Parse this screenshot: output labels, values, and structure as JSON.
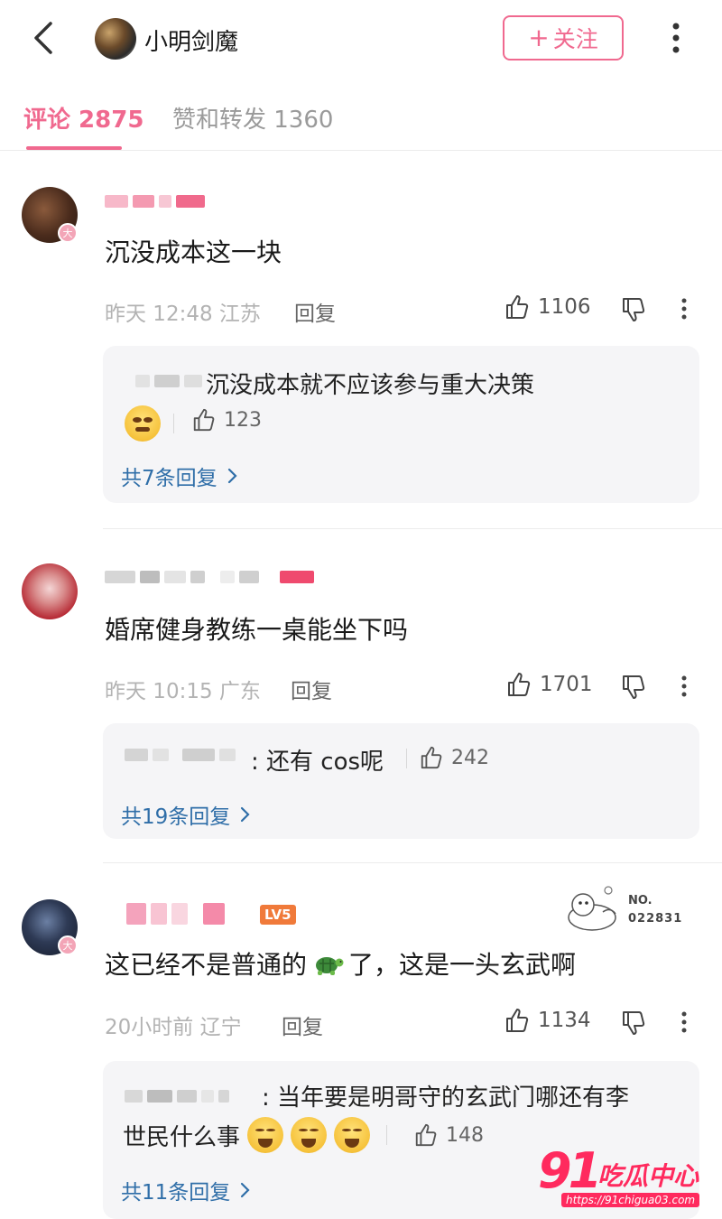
{
  "header": {
    "title": "小明剑魔",
    "follow_label": "关注",
    "follow_plus": "+"
  },
  "tabs": [
    {
      "label": "评论 2875",
      "active": true
    },
    {
      "label": "赞和转发 1360",
      "active": false
    }
  ],
  "comments": [
    {
      "text": "沉没成本这一块",
      "time": "昨天 12:48",
      "location": "江苏",
      "reply_label": "回复",
      "likes": "1106",
      "avatar_badge": "大",
      "reply": {
        "text": "沉没成本就不应该参与重大决策",
        "likes": "123",
        "count_label": "共7条回复"
      }
    },
    {
      "text": "婚席健身教练一桌能坐下吗",
      "time": "昨天 10:15",
      "location": "广东",
      "reply_label": "回复",
      "likes": "1701",
      "reply": {
        "text": ": 还有 cos呢",
        "likes": "242",
        "count_label": "共19条回复"
      }
    },
    {
      "text_before": "这已经不是普通的",
      "text_after": "了，这是一头玄武啊",
      "time": "20小时前",
      "location": "辽宁",
      "reply_label": "回复",
      "likes": "1134",
      "avatar_badge": "大",
      "level_badge": "LV5",
      "card_no_label": "NO.",
      "card_no": "022831",
      "reply": {
        "text_line1": ": 当年要是明哥守的玄武门哪还有李",
        "text_line2": "世民什么事",
        "likes": "148",
        "count_label": "共11条回复"
      }
    }
  ],
  "watermark": {
    "logo": "91",
    "name": "吃瓜中心",
    "url": "https://91chigua03.com"
  },
  "colors": {
    "accent": "#f0698f",
    "link": "#2f6ea8"
  }
}
